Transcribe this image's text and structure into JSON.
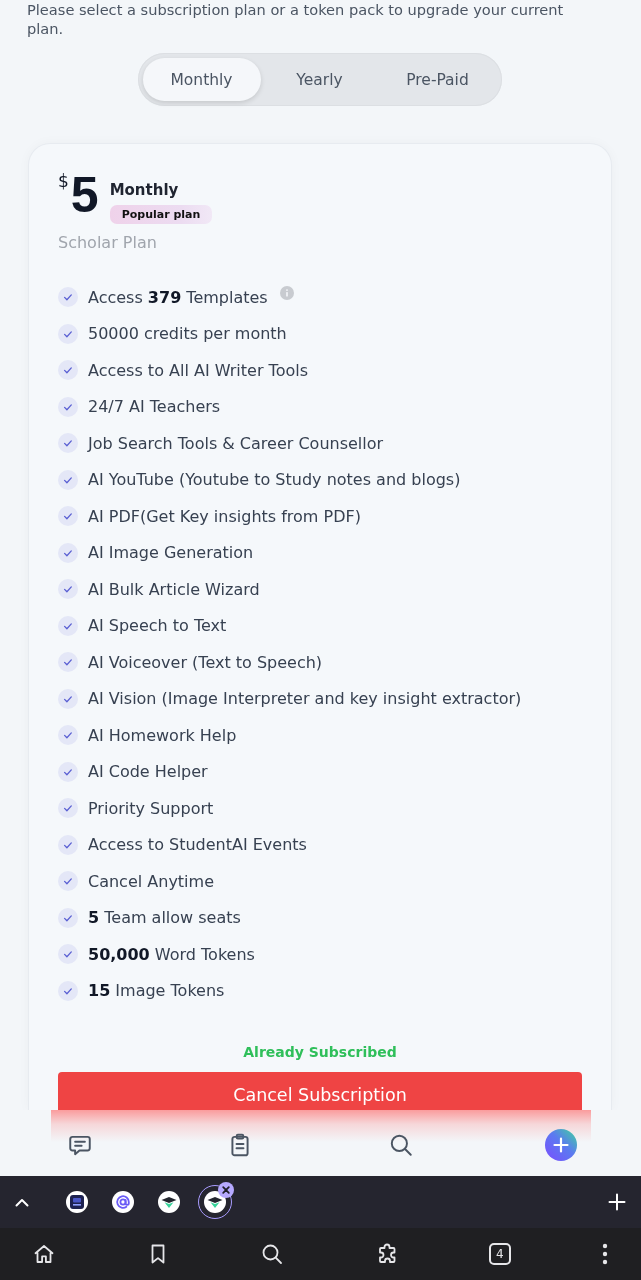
{
  "intro": "Please select a subscription plan or a token pack to upgrade your current plan.",
  "billing_tabs": [
    {
      "label": "Monthly",
      "selected": true
    },
    {
      "label": "Yearly",
      "selected": false
    },
    {
      "label": "Pre-Paid",
      "selected": false
    }
  ],
  "plan": {
    "currency": "$",
    "price": "5",
    "period": "Monthly",
    "tag": "Popular plan",
    "name": "Scholar Plan",
    "features": [
      {
        "text": "Access **379** Templates",
        "info": true
      },
      {
        "text": "50000 credits per month",
        "info": false
      },
      {
        "text": "Access to All AI Writer Tools",
        "info": false
      },
      {
        "text": "24/7 AI Teachers",
        "info": false
      },
      {
        "text": "Job Search Tools & Career Counsellor",
        "info": false
      },
      {
        "text": "AI YouTube (Youtube to Study notes and blogs)",
        "info": false
      },
      {
        "text": "AI PDF(Get Key insights from PDF)",
        "info": false
      },
      {
        "text": "AI Image Generation",
        "info": false
      },
      {
        "text": "AI Bulk Article Wizard",
        "info": false
      },
      {
        "text": "AI Speech to Text",
        "info": false
      },
      {
        "text": "AI Voiceover (Text to Speech)",
        "info": false
      },
      {
        "text": "AI Vision (Image Interpreter and key insight extractor)",
        "info": false
      },
      {
        "text": "AI Homework Help",
        "info": false
      },
      {
        "text": "AI Code Helper",
        "info": false
      },
      {
        "text": "Priority Support",
        "info": false
      },
      {
        "text": "Access to StudentAI Events",
        "info": false
      },
      {
        "text": "Cancel Anytime",
        "info": false
      },
      {
        "text": "**5** Team allow seats",
        "info": false
      },
      {
        "text": "**50,000** Word Tokens",
        "info": false
      },
      {
        "text": "**15** Image Tokens",
        "info": false
      }
    ],
    "status": "Already Subscribed",
    "cancel_button": "Cancel Subscription"
  },
  "browser_tabs": [
    {
      "kind": "square",
      "selected": false
    },
    {
      "kind": "at",
      "selected": false
    },
    {
      "kind": "cap",
      "selected": false
    },
    {
      "kind": "cap",
      "selected": true
    }
  ],
  "toolbar": {
    "tab_count": "4"
  }
}
